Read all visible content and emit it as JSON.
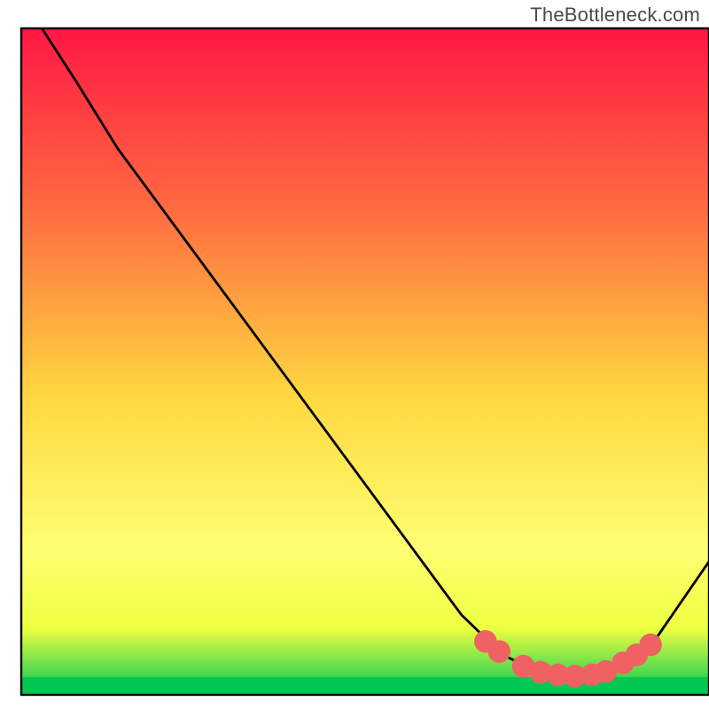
{
  "watermark": "TheBottleneck.com",
  "chart_data": {
    "type": "line",
    "title": "",
    "xlabel": "",
    "ylabel": "",
    "xlim": [
      0,
      100
    ],
    "ylim": [
      0,
      100
    ],
    "gradient_bg": {
      "top": "#ff1744",
      "upper_mid": "#ff6e40",
      "mid": "#ffd740",
      "lower_mid": "#ffff72",
      "band": "#eeff41",
      "bottom_band": "#00c853"
    },
    "series": [
      {
        "name": "curve",
        "line_color": "#000000",
        "points": [
          {
            "x": 3,
            "y": 100
          },
          {
            "x": 8,
            "y": 92
          },
          {
            "x": 14,
            "y": 82
          },
          {
            "x": 64,
            "y": 12
          },
          {
            "x": 70,
            "y": 6
          },
          {
            "x": 76,
            "y": 3
          },
          {
            "x": 82,
            "y": 2.5
          },
          {
            "x": 88,
            "y": 4
          },
          {
            "x": 92,
            "y": 8
          },
          {
            "x": 100,
            "y": 20
          }
        ]
      }
    ],
    "dots": {
      "color": "#f06262",
      "radius": 1.6,
      "points": [
        {
          "x": 67.5,
          "y": 8
        },
        {
          "x": 69.5,
          "y": 6.5
        },
        {
          "x": 73,
          "y": 4.3
        },
        {
          "x": 75.5,
          "y": 3.4
        },
        {
          "x": 78,
          "y": 3.0
        },
        {
          "x": 80.5,
          "y": 2.8
        },
        {
          "x": 83,
          "y": 3.0
        },
        {
          "x": 85,
          "y": 3.5
        },
        {
          "x": 87.5,
          "y": 4.8
        },
        {
          "x": 89.5,
          "y": 6.0
        },
        {
          "x": 91.5,
          "y": 7.5
        }
      ]
    },
    "frame": {
      "x": 3,
      "y": 4,
      "width": 97,
      "height": 94,
      "stroke": "#000000",
      "stroke_width": 0.3
    }
  }
}
